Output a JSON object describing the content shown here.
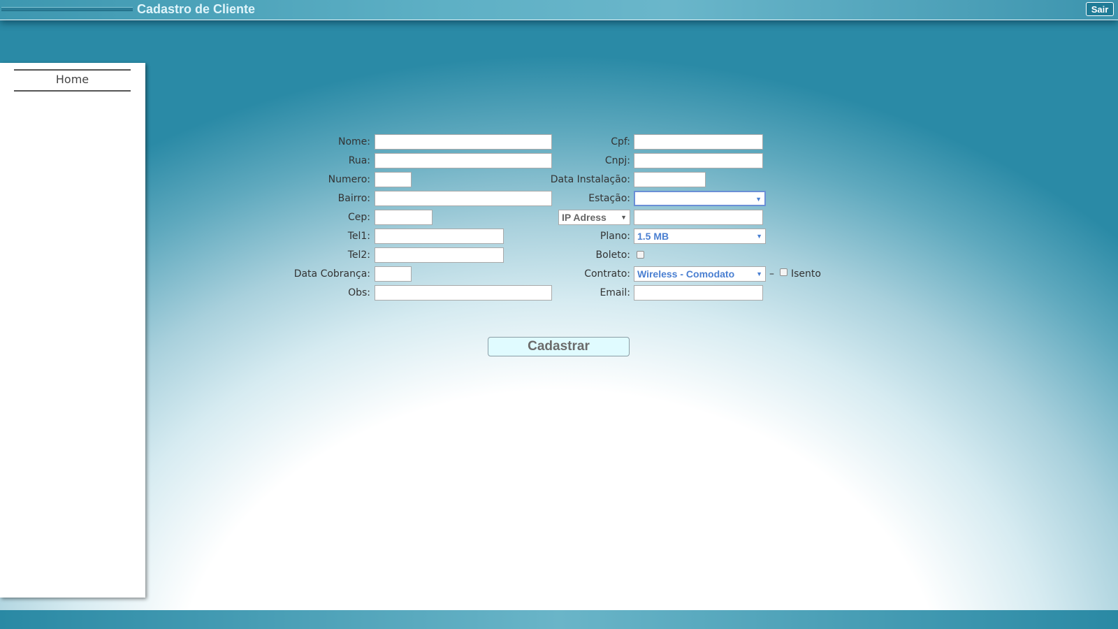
{
  "header": {
    "title": "Cadastro de Cliente",
    "logout_label": "Sair"
  },
  "sidebar": {
    "items": [
      {
        "label": "Home"
      }
    ]
  },
  "form": {
    "left": {
      "nome_label": "Nome:",
      "nome_value": "",
      "rua_label": "Rua:",
      "rua_value": "",
      "numero_label": "Numero:",
      "numero_value": "",
      "bairro_label": "Bairro:",
      "bairro_value": "",
      "cep_label": "Cep:",
      "cep_value": "",
      "tel1_label": "Tel1:",
      "tel1_value": "",
      "tel2_label": "Tel2:",
      "tel2_value": "",
      "data_cobranca_label": "Data Cobrança:",
      "data_cobranca_value": "",
      "obs_label": "Obs:",
      "obs_value": ""
    },
    "right": {
      "cpf_label": "Cpf:",
      "cpf_value": "",
      "cnpj_label": "Cnpj:",
      "cnpj_value": "",
      "data_instalacao_label": "Data Instalação:",
      "data_instalacao_value": "",
      "estacao_label": "Estação:",
      "estacao_selected": "",
      "ip_type_selected": "IP Adress",
      "ip_value": "",
      "plano_label": "Plano:",
      "plano_selected": "1.5 MB",
      "boleto_label": "Boleto:",
      "boleto_checked": false,
      "contrato_label": "Contrato:",
      "contrato_selected": "Wireless - Comodato",
      "contrato_separator": "–",
      "isento_label": "Isento",
      "isento_checked": false,
      "email_label": "Email:",
      "email_value": ""
    },
    "submit_label": "Cadastrar"
  },
  "icons": {
    "dropdown": "chevron-down-icon",
    "checkbox": "checkbox-icon"
  },
  "colors": {
    "topbar": "#3d97b0",
    "select_text": "#4a7fd1",
    "button_bg": "#e0fbff"
  }
}
